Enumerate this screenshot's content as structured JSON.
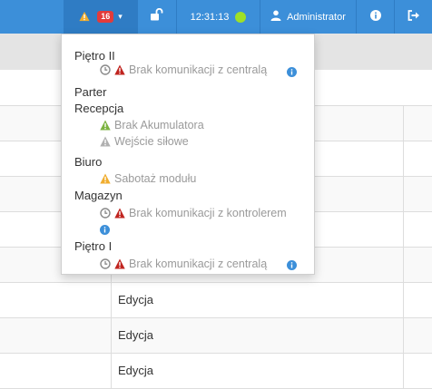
{
  "colors": {
    "navbar": "#3c8fd9",
    "alert_warning": "#f0ad2e",
    "alert_danger": "#c0241f",
    "alert_ok": "#7cb340",
    "alert_muted": "#b0b0b0",
    "status_ok": "#9ee028",
    "info": "#3c8fd9",
    "badge": "#e23b3b"
  },
  "navbar": {
    "alerts": {
      "icon": "warning-icon",
      "count": "16",
      "caret": "▾"
    },
    "lock": {
      "icon": "unlock-icon"
    },
    "clock": {
      "time": "12:31:13",
      "status": "status-dot"
    },
    "user": {
      "icon": "user-icon",
      "name": "Administrator"
    },
    "info": {
      "icon": "info-icon"
    },
    "logout": {
      "icon": "logout-icon"
    }
  },
  "dropdown": {
    "zones": [
      {
        "name": "Piętro II",
        "alarms": [
          {
            "icons": [
              "clock-icon",
              "danger-triangle-icon"
            ],
            "text": "Brak komunikacji z centralą",
            "info": true
          }
        ]
      },
      {
        "name": "Parter",
        "alarms": []
      },
      {
        "name": "Recepcja",
        "alarms": [
          {
            "icons": [
              "ok-triangle-icon"
            ],
            "text": "Brak Akumulatora"
          },
          {
            "icons": [
              "muted-triangle-icon"
            ],
            "text": "Wejście siłowe"
          }
        ]
      },
      {
        "name": "Biuro",
        "alarms": [
          {
            "icons": [
              "warning-triangle-icon"
            ],
            "text": "Sabotaż modułu"
          }
        ]
      },
      {
        "name": "Magazyn",
        "alarms": [
          {
            "icons": [
              "clock-icon",
              "danger-triangle-icon"
            ],
            "text": "Brak komunikacji z kontrolerem",
            "info": true
          }
        ]
      },
      {
        "name": "Piętro I",
        "alarms": [
          {
            "icons": [
              "clock-icon",
              "danger-triangle-icon"
            ],
            "text": "Brak komunikacji z centralą",
            "info": true
          }
        ]
      }
    ]
  },
  "table": {
    "rows": [
      {
        "col2": ""
      },
      {
        "col2": ""
      },
      {
        "col2": ""
      },
      {
        "col2": ""
      },
      {
        "col2": ""
      },
      {
        "col2": "Edycja"
      },
      {
        "col2": "Edycja"
      },
      {
        "col2": "Edycja"
      }
    ]
  }
}
